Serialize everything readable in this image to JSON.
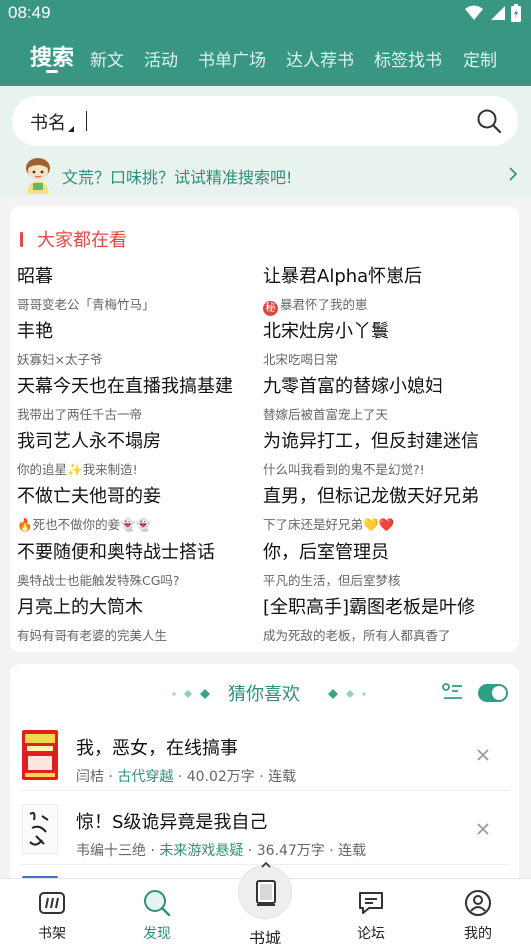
{
  "status_bar": {
    "time": "08:49"
  },
  "tabs": [
    {
      "label": "搜索",
      "active": true
    },
    {
      "label": "新文"
    },
    {
      "label": "活动"
    },
    {
      "label": "书单广场"
    },
    {
      "label": "达人荐书"
    },
    {
      "label": "标签找书"
    },
    {
      "label": "定制"
    }
  ],
  "search": {
    "category": "书名"
  },
  "tip": {
    "text": "文荒？口味挑？试试精准搜索吧!"
  },
  "hot": {
    "title": "大家都在看",
    "items": [
      {
        "title": "昭暮",
        "subtitle": "哥哥变老公「青梅竹马」"
      },
      {
        "title": "让暴君Alpha怀崽后",
        "badge": "秘",
        "subtitle": "暴君怀了我的崽"
      },
      {
        "title": "丰艳",
        "subtitle": "妖寡妇×太子爷"
      },
      {
        "title": "北宋灶房小丫鬟",
        "subtitle": "北宋吃喝日常"
      },
      {
        "title": "天幕今天也在直播我搞基建",
        "subtitle": "我带出了两任千古一帝"
      },
      {
        "title": "九零首富的替嫁小媳妇",
        "subtitle": "替嫁后被首富宠上了天"
      },
      {
        "title": "我司艺人永不塌房",
        "subtitle": "你的追星✨我来制造!"
      },
      {
        "title": "为诡异打工，但反封建迷信",
        "subtitle": "什么叫我看到的鬼不是幻觉?!"
      },
      {
        "title": "不做亡夫他哥的妾",
        "subtitle": "🔥死也不做你的妾👻👻"
      },
      {
        "title": "直男，但标记龙傲天好兄弟",
        "subtitle": "下了床还是好兄弟💛❤️"
      },
      {
        "title": "不要随便和奥特战士搭话",
        "subtitle": "奥特战士也能触发特殊CG吗?"
      },
      {
        "title": "你，后室管理员",
        "subtitle": "平凡的生活，但后室梦核"
      },
      {
        "title": "月亮上的大筒木",
        "subtitle": "有妈有哥有老婆的完美人生"
      },
      {
        "title": "[全职高手]霸图老板是叶修",
        "subtitle": "成为死敌的老板，所有人都真香了"
      }
    ]
  },
  "guess": {
    "title": "猜你喜欢",
    "toggle_on": true,
    "books": [
      {
        "title": "我，恶女，在线搞事",
        "author": "闫桔",
        "genre": "古代穿越",
        "words": "40.02万字",
        "status": "连载",
        "cover_text": "我，恶女，在线搞事"
      },
      {
        "title": "惊！S级诡异竟是我自己",
        "author": "韦编十三绝",
        "genre": "未来游戏悬疑",
        "words": "36.47万字",
        "status": "连载",
        "cover_text": "诡神弟"
      }
    ]
  },
  "bottom_nav": [
    {
      "label": "书架",
      "icon": "bookshelf-icon"
    },
    {
      "label": "发现",
      "icon": "discover-icon",
      "active": true
    },
    {
      "label": "书城",
      "icon": "book-icon"
    },
    {
      "label": "论坛",
      "icon": "forum-icon"
    },
    {
      "label": "我的",
      "icon": "profile-icon"
    }
  ],
  "colors": {
    "primary": "#389683",
    "accent_text": "#2f8f7a",
    "hot_red": "#e74a44"
  }
}
